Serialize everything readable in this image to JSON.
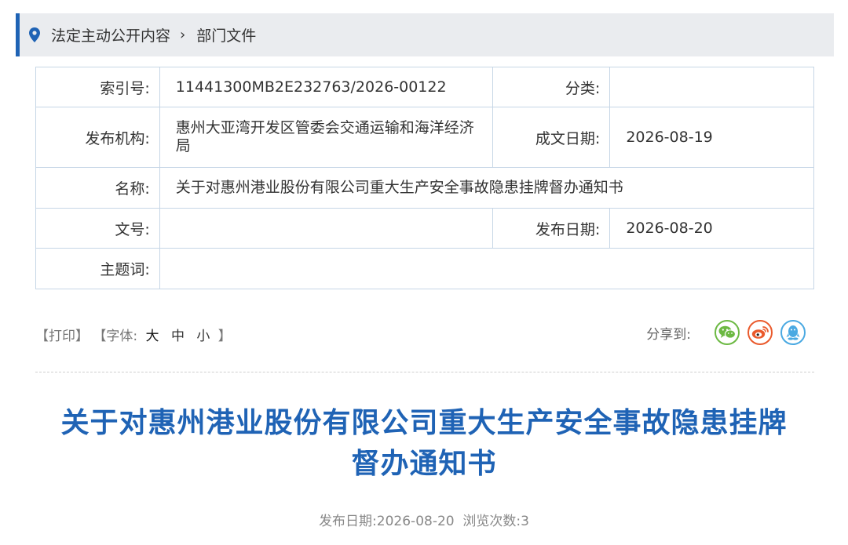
{
  "breadcrumb": {
    "home": "法定主动公开内容",
    "separator": "›",
    "current": "部门文件",
    "icon": "location-pin-icon"
  },
  "meta": {
    "index_label": "索引号:",
    "index_value": "11441300MB2E232763/2026-00122",
    "category_label": "分类:",
    "category_value": "",
    "publisher_label": "发布机构:",
    "publisher_value": "惠州大亚湾开发区管委会交通运输和海洋经济局",
    "created_label": "成文日期:",
    "created_value": "2026-08-19",
    "name_label": "名称:",
    "name_value": "关于对惠州港业股份有限公司重大生产安全事故隐患挂牌督办通知书",
    "docno_label": "文号:",
    "docno_value": "",
    "pubdate_label": "发布日期:",
    "pubdate_value": "2026-08-20",
    "keywords_label": "主题词:",
    "keywords_value": ""
  },
  "tools": {
    "print": "【打印】",
    "font_open": "【字体:",
    "font_large": "大",
    "font_medium": "中",
    "font_small": "小",
    "font_close": "】"
  },
  "share": {
    "label": "分享到:",
    "buttons": [
      "wechat-icon",
      "weibo-icon",
      "qq-icon"
    ]
  },
  "article": {
    "title_line1": "关于对惠州港业股份有限公司重大生产安全事故隐患挂牌",
    "title_line2": "督办通知书",
    "pubinfo": "发布日期:2026-08-20  浏览次数:3"
  },
  "colors": {
    "accent": "#1f63b5",
    "breadcrumb_bg": "#eaecef",
    "table_border": "#c6d6e6",
    "wechat": "#6cb943",
    "weibo": "#ea5a2c",
    "qq": "#4aa9e2"
  }
}
